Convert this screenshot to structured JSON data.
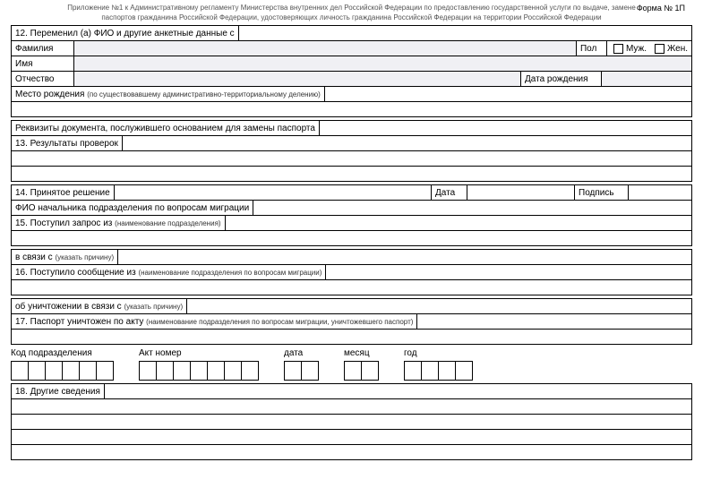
{
  "header": {
    "line1": "Приложение №1 к Административному регламенту Министерства внутренних дел Российской Федерации по предоставлению государственной услуги по выдаче, замене",
    "line2": "паспортов гражданина Российской Федерации, удостоверяющих личность гражданина Российской Федерации на территории Российской Федерации",
    "form_no": "Форма № 1П"
  },
  "section12": {
    "title": "12. Переменил (а) ФИО и другие анкетные данные с",
    "surname": "Фамилия",
    "sex": "Пол",
    "male": "Муж.",
    "female": "Жен.",
    "name": "Имя",
    "patronymic": "Отчество",
    "dob": "Дата рождения",
    "birthplace": "Место рождения",
    "birthplace_note": "(по существовавшему административно-территориальному делению)",
    "doc_basis": "Реквизиты документа, послужившего основанием для замены паспорта"
  },
  "section13": {
    "title": "13. Результаты проверок"
  },
  "section14": {
    "title": "14. Принятое решение",
    "date": "Дата",
    "sign": "Подпись",
    "chief": "ФИО начальника подразделения по вопросам миграции"
  },
  "section15": {
    "title": "15. Поступил запрос из",
    "note": "(наименование подразделения)",
    "due": "в связи с",
    "due_note": "(указать причину)"
  },
  "section16": {
    "title": "16. Поступило сообщение из",
    "note": "(наименование подразделения по вопросам миграции)",
    "destr": "об уничтожении в связи с",
    "destr_note": "(указать причину)"
  },
  "section17": {
    "title": "17. Паспорт уничтожен по акту",
    "note": "(наименование подразделения по вопросам миграции, уничтожевшего паспорт)"
  },
  "boxes": {
    "dept": "Код подразделения",
    "act": "Акт номер",
    "day": "дата",
    "month": "месяц",
    "year": "год"
  },
  "section18": {
    "title": "18. Другие сведения"
  }
}
